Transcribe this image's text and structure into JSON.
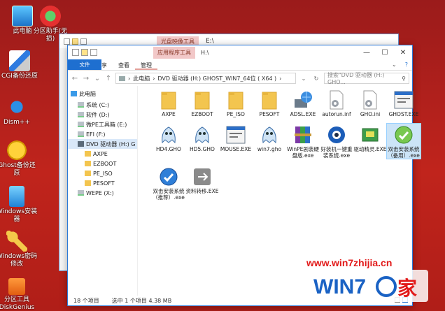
{
  "desktop": {
    "icons": [
      {
        "label": "此电脑",
        "icon": "computer-icon"
      },
      {
        "label": "分区助手(无损)",
        "icon": "partition-assistant-icon"
      },
      {
        "label": "CGI备份还原",
        "icon": "cgi-backup-icon"
      },
      {
        "label": "Dism++",
        "icon": "dism-gear-icon"
      },
      {
        "label": "Ghost备份还原",
        "icon": "ghost-icon"
      },
      {
        "label": "Windows安装器",
        "icon": "windows-installer-icon"
      },
      {
        "label": "Windows密码修改",
        "icon": "key-icon"
      },
      {
        "label": "分区工具DiskGenius",
        "icon": "diskgenius-icon"
      }
    ]
  },
  "back_window": {
    "context_tab": "光盘映像工具",
    "title": "E:\\"
  },
  "window": {
    "context_tab": "应用程序工具",
    "title": "H:\\",
    "controls": {
      "minimize": "—",
      "maximize": "☐",
      "close": "✕"
    },
    "ribbon": {
      "file": "文件",
      "home": "主页",
      "share": "共享",
      "view": "查看",
      "manage": "管理"
    },
    "address": {
      "path": [
        "此电脑",
        "DVD 驱动器 (H:) GHOST_WIN7_64位 ( X64 )"
      ]
    },
    "search": {
      "placeholder": "搜索\"DVD 驱动器 (H:) GHO..."
    },
    "nav": [
      {
        "label": "此电脑",
        "icon": "computer-icon",
        "indent": 0,
        "selected": false
      },
      {
        "label": "系统 (C:)",
        "icon": "drive-icon",
        "indent": 1,
        "selected": false
      },
      {
        "label": "软件 (D:)",
        "icon": "drive-icon",
        "indent": 1,
        "selected": false
      },
      {
        "label": "微PE工具箱 (E:)",
        "icon": "drive-icon",
        "indent": 1,
        "selected": false
      },
      {
        "label": "EFI (F:)",
        "icon": "drive-icon",
        "indent": 1,
        "selected": false
      },
      {
        "label": "DVD 驱动器 (H:) G",
        "icon": "dvd-icon",
        "indent": 1,
        "selected": true
      },
      {
        "label": "AXPE",
        "icon": "folder-icon",
        "indent": 2,
        "selected": false
      },
      {
        "label": "EZBOOT",
        "icon": "folder-icon",
        "indent": 2,
        "selected": false
      },
      {
        "label": "PE_ISO",
        "icon": "folder-icon",
        "indent": 2,
        "selected": false
      },
      {
        "label": "PESOFT",
        "icon": "folder-icon",
        "indent": 2,
        "selected": false
      },
      {
        "label": "WEPE (X:)",
        "icon": "drive-icon",
        "indent": 1,
        "selected": false
      }
    ],
    "files": [
      {
        "name": "AXPE",
        "icon": "folder-icon",
        "selected": false
      },
      {
        "name": "EZBOOT",
        "icon": "folder-icon",
        "selected": false
      },
      {
        "name": "PE_ISO",
        "icon": "folder-icon",
        "selected": false
      },
      {
        "name": "PESOFT",
        "icon": "folder-icon",
        "selected": false
      },
      {
        "name": "ADSL.EXE",
        "icon": "network-globe-icon",
        "selected": false
      },
      {
        "name": "autorun.inf",
        "icon": "settings-file-icon",
        "selected": false
      },
      {
        "name": "GHO.ini",
        "icon": "settings-file-icon",
        "selected": false
      },
      {
        "name": "GHOST.EXE",
        "icon": "window-app-icon",
        "selected": false
      },
      {
        "name": "HD4.GHO",
        "icon": "ghost-file-icon",
        "selected": false
      },
      {
        "name": "HD5.GHO",
        "icon": "ghost-file-icon",
        "selected": false
      },
      {
        "name": "MOUSE.EXE",
        "icon": "window-app-icon",
        "selected": false
      },
      {
        "name": "win7.gho",
        "icon": "ghost-file-icon",
        "selected": false
      },
      {
        "name": "WinPE剧装硬盘版.exe",
        "icon": "winrar-icon",
        "selected": false
      },
      {
        "name": "好装机一键重装系统.exe",
        "icon": "eye-app-icon",
        "selected": false
      },
      {
        "name": "驱动精灵.EXE",
        "icon": "driver-icon",
        "selected": false
      },
      {
        "name": "双击安装系统（备用）.exe",
        "icon": "install-green-icon",
        "selected": true
      },
      {
        "name": "双击安装系统（推荐）.exe",
        "icon": "install-blue-icon",
        "selected": false
      },
      {
        "name": "资料转移.EXE",
        "icon": "transfer-app-icon",
        "selected": false
      }
    ],
    "status": {
      "count": "18 个项目",
      "selected": "选中 1 个项目  4.38 MB"
    }
  },
  "watermark": {
    "url": "www.win7zhijia.cn",
    "logo": "WIN7之家"
  },
  "colors": {
    "desktop": "#b01e18",
    "accent": "#1e6fd0",
    "context_tab": "#f2c8c8",
    "selection": "#cce4f7"
  }
}
